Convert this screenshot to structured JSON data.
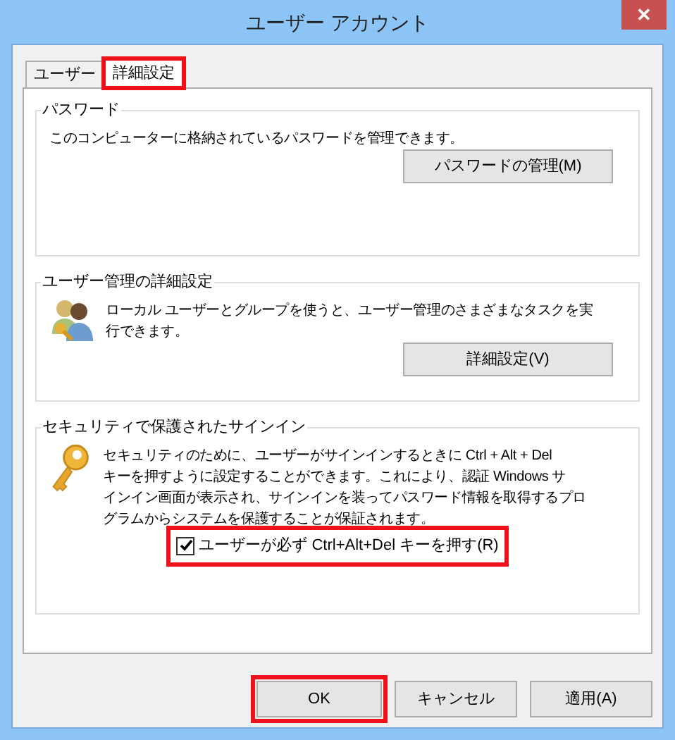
{
  "window": {
    "title": "ユーザー アカウント",
    "close": "✕"
  },
  "tabs": [
    {
      "label": "ユーザー",
      "selected": false,
      "highlighted": false
    },
    {
      "label": "詳細設定",
      "selected": true,
      "highlighted": true
    }
  ],
  "groups": [
    {
      "kind": "password",
      "title": "パスワード",
      "lines": [
        "このコンピューターに格納されているパスワードを管理できます。"
      ],
      "button": "パスワードの管理(M)"
    },
    {
      "kind": "users",
      "title": "ユーザー管理の詳細設定",
      "lines": [
        "ローカル ユーザーとグループを使うと、ユーザー管理のさまざまなタスクを実",
        "行できます。"
      ],
      "button": "詳細設定(V)"
    },
    {
      "kind": "key",
      "title": "セキュリティで保護されたサインイン",
      "lines": [
        "セキュリティのために、ユーザーがサインインするときに Ctrl + Alt + Del",
        "キーを押すように設定することができます。これにより、認証 Windows サ",
        "インイン画面が表示され、サインインを装ってパスワード情報を取得するプロ",
        "グラムからシステムを保護することが保証されます。"
      ],
      "checkbox": {
        "label": "ユーザーが必ず Ctrl+Alt+Del キーを押す(R)",
        "checked": true,
        "highlighted": true
      }
    }
  ],
  "buttons": [
    {
      "label": "OK",
      "highlighted": true
    },
    {
      "label": "キャンセル",
      "highlighted": false
    },
    {
      "label": "適用(A)",
      "highlighted": false
    }
  ]
}
